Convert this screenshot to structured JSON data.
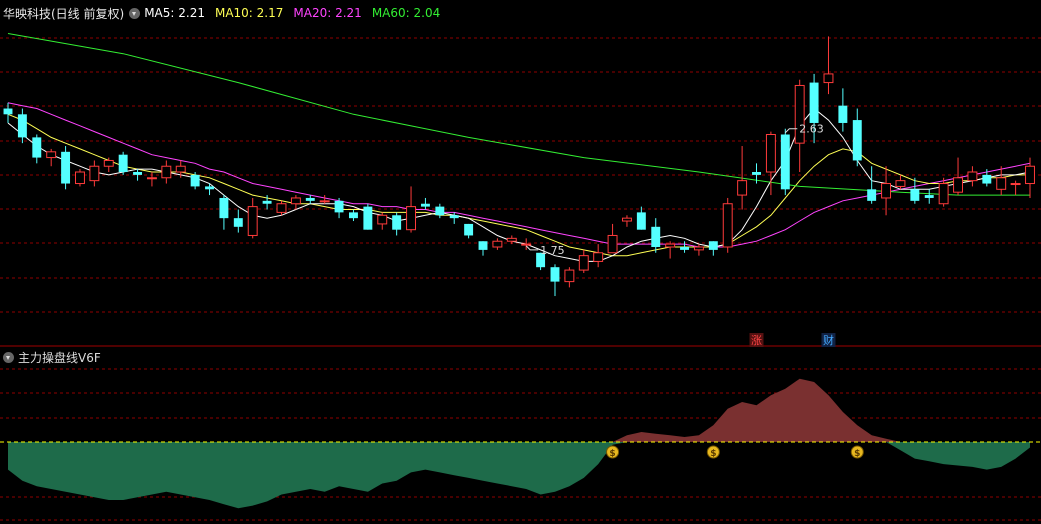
{
  "header": {
    "stock": "华映科技(日线 前复权)",
    "ma": [
      {
        "label": "MA5: 2.21",
        "color": "#ffffff"
      },
      {
        "label": "MA10: 2.17",
        "color": "#ffff55"
      },
      {
        "label": "MA20: 2.21",
        "color": "#ff44ff"
      },
      {
        "label": "MA60: 2.04",
        "color": "#33ee33"
      }
    ]
  },
  "indicator": {
    "title": "主力操盘线V6F"
  },
  "colors": {
    "up": "#ff3b3b",
    "down": "#54ffff",
    "green_area": "#1e6b4a",
    "red_area": "#7a3030",
    "zero_line": "#ffff00",
    "grid": "#c00000"
  },
  "chart_data": [
    {
      "type": "candlestick",
      "title": "",
      "ylim": [
        1.66,
        2.7
      ],
      "annotations": [
        {
          "text": "2.63",
          "at": "high",
          "index": 54
        },
        {
          "text": "1.75",
          "at": "low",
          "index": 36
        },
        {
          "text": "涨",
          "index": 52,
          "color": "#ff4444",
          "bg": "#551111"
        },
        {
          "text": "财",
          "index": 57,
          "color": "#44aaff",
          "bg": "#112244"
        }
      ],
      "ohlc": [
        [
          2.4,
          2.42,
          2.35,
          2.38
        ],
        [
          2.38,
          2.4,
          2.28,
          2.3
        ],
        [
          2.3,
          2.31,
          2.21,
          2.23
        ],
        [
          2.23,
          2.26,
          2.2,
          2.25
        ],
        [
          2.25,
          2.27,
          2.12,
          2.14
        ],
        [
          2.14,
          2.19,
          2.13,
          2.18
        ],
        [
          2.15,
          2.22,
          2.13,
          2.2
        ],
        [
          2.2,
          2.23,
          2.18,
          2.22
        ],
        [
          2.24,
          2.25,
          2.17,
          2.18
        ],
        [
          2.18,
          2.19,
          2.15,
          2.17
        ],
        [
          2.16,
          2.18,
          2.13,
          2.16
        ],
        [
          2.16,
          2.22,
          2.14,
          2.2
        ],
        [
          2.18,
          2.22,
          2.16,
          2.2
        ],
        [
          2.17,
          2.18,
          2.12,
          2.13
        ],
        [
          2.13,
          2.14,
          2.1,
          2.12
        ],
        [
          2.09,
          2.1,
          1.98,
          2.02
        ],
        [
          2.02,
          2.05,
          1.97,
          1.99
        ],
        [
          1.96,
          2.09,
          1.95,
          2.06
        ],
        [
          2.08,
          2.1,
          2.05,
          2.07
        ],
        [
          2.04,
          2.08,
          2.03,
          2.07
        ],
        [
          2.07,
          2.1,
          2.05,
          2.09
        ],
        [
          2.09,
          2.1,
          2.07,
          2.08
        ],
        [
          2.08,
          2.1,
          2.07,
          2.08
        ],
        [
          2.08,
          2.09,
          2.02,
          2.04
        ],
        [
          2.04,
          2.05,
          2.01,
          2.02
        ],
        [
          2.06,
          2.07,
          1.98,
          1.98
        ],
        [
          2.0,
          2.04,
          1.98,
          2.03
        ],
        [
          2.03,
          2.04,
          1.96,
          1.98
        ],
        [
          1.98,
          2.13,
          1.97,
          2.06
        ],
        [
          2.07,
          2.09,
          2.05,
          2.06
        ],
        [
          2.06,
          2.07,
          2.02,
          2.03
        ],
        [
          2.03,
          2.04,
          2.0,
          2.02
        ],
        [
          2.0,
          2.0,
          1.95,
          1.96
        ],
        [
          1.94,
          1.94,
          1.89,
          1.91
        ],
        [
          1.92,
          1.95,
          1.91,
          1.94
        ],
        [
          1.94,
          1.96,
          1.93,
          1.95
        ],
        [
          1.93,
          1.95,
          1.91,
          1.93
        ],
        [
          1.9,
          1.9,
          1.84,
          1.85
        ],
        [
          1.85,
          1.86,
          1.75,
          1.8
        ],
        [
          1.8,
          1.85,
          1.78,
          1.84
        ],
        [
          1.84,
          1.91,
          1.83,
          1.89
        ],
        [
          1.87,
          1.93,
          1.85,
          1.9
        ],
        [
          1.9,
          2.0,
          1.9,
          1.96
        ],
        [
          2.01,
          2.03,
          1.99,
          2.02
        ],
        [
          2.04,
          2.06,
          1.98,
          1.98
        ],
        [
          1.99,
          2.02,
          1.9,
          1.92
        ],
        [
          1.92,
          1.94,
          1.88,
          1.93
        ],
        [
          1.92,
          1.94,
          1.9,
          1.91
        ],
        [
          1.91,
          1.93,
          1.89,
          1.92
        ],
        [
          1.94,
          1.94,
          1.89,
          1.91
        ],
        [
          1.92,
          2.09,
          1.9,
          2.07
        ],
        [
          2.1,
          2.27,
          2.05,
          2.15
        ]
      ],
      "ohlc_b": [
        [
          2.18,
          2.21,
          2.14,
          2.17
        ],
        [
          2.18,
          2.32,
          2.1,
          2.31
        ],
        [
          2.31,
          2.33,
          2.1,
          2.12
        ],
        [
          2.28,
          2.5,
          2.18,
          2.48
        ],
        [
          2.49,
          2.52,
          2.28,
          2.35
        ],
        [
          2.49,
          2.65,
          2.45,
          2.52
        ],
        [
          2.41,
          2.47,
          2.32,
          2.35
        ],
        [
          2.36,
          2.4,
          2.2,
          2.22
        ],
        [
          2.12,
          2.2,
          2.07,
          2.08
        ],
        [
          2.09,
          2.2,
          2.03,
          2.14
        ],
        [
          2.13,
          2.17,
          2.12,
          2.15
        ],
        [
          2.12,
          2.16,
          2.07,
          2.08
        ],
        [
          2.1,
          2.12,
          2.07,
          2.09
        ],
        [
          2.07,
          2.16,
          2.06,
          2.14
        ],
        [
          2.11,
          2.23,
          2.1,
          2.16
        ],
        [
          2.15,
          2.2,
          2.13,
          2.18
        ],
        [
          2.17,
          2.19,
          2.13,
          2.14
        ],
        [
          2.12,
          2.2,
          2.1,
          2.16
        ],
        [
          2.14,
          2.15,
          2.1,
          2.14
        ],
        [
          2.14,
          2.23,
          2.09,
          2.2
        ]
      ],
      "ma5": [
        2.35,
        2.31,
        2.27,
        2.24,
        2.22,
        2.2,
        2.18,
        2.17,
        2.18,
        2.19,
        2.19,
        2.18,
        2.17,
        2.16,
        2.14,
        2.1,
        2.06,
        2.03,
        2.02,
        2.03,
        2.05,
        2.07,
        2.07,
        2.07,
        2.06,
        2.04,
        2.03,
        2.01,
        2.02,
        2.03,
        2.04,
        2.03,
        2.02,
        1.99,
        1.96,
        1.94,
        1.93,
        1.91,
        1.89,
        1.88,
        1.87,
        1.87,
        1.89,
        1.92,
        1.94,
        1.95,
        1.96,
        1.95,
        1.93,
        1.92,
        1.93,
        1.98,
        2.06,
        2.15,
        2.22,
        2.34,
        2.4,
        2.36,
        2.3,
        2.22,
        2.15,
        2.14,
        2.12,
        2.12,
        2.12,
        2.13,
        2.14,
        2.15,
        2.16,
        2.17,
        2.17,
        2.18
      ],
      "ma10": [
        2.38,
        2.36,
        2.33,
        2.3,
        2.28,
        2.26,
        2.24,
        2.22,
        2.2,
        2.19,
        2.18,
        2.18,
        2.18,
        2.17,
        2.16,
        2.14,
        2.12,
        2.1,
        2.09,
        2.08,
        2.07,
        2.07,
        2.06,
        2.05,
        2.05,
        2.05,
        2.04,
        2.04,
        2.04,
        2.04,
        2.03,
        2.03,
        2.02,
        2.01,
        2.0,
        1.99,
        1.98,
        1.96,
        1.94,
        1.92,
        1.91,
        1.9,
        1.89,
        1.89,
        1.9,
        1.91,
        1.92,
        1.92,
        1.92,
        1.92,
        1.93,
        1.96,
        1.99,
        2.03,
        2.09,
        2.15,
        2.2,
        2.24,
        2.26,
        2.25,
        2.21,
        2.19,
        2.17,
        2.15,
        2.14,
        2.14,
        2.15,
        2.15,
        2.16,
        2.16,
        2.17,
        2.17
      ],
      "ma20": [
        2.42,
        2.41,
        2.4,
        2.38,
        2.36,
        2.34,
        2.32,
        2.3,
        2.28,
        2.26,
        2.24,
        2.23,
        2.22,
        2.21,
        2.19,
        2.18,
        2.16,
        2.14,
        2.13,
        2.12,
        2.11,
        2.1,
        2.09,
        2.08,
        2.07,
        2.07,
        2.06,
        2.06,
        2.05,
        2.05,
        2.04,
        2.04,
        2.03,
        2.02,
        2.01,
        2.0,
        1.99,
        1.98,
        1.97,
        1.96,
        1.95,
        1.94,
        1.93,
        1.93,
        1.93,
        1.93,
        1.93,
        1.93,
        1.92,
        1.92,
        1.92,
        1.93,
        1.94,
        1.96,
        1.98,
        2.01,
        2.04,
        2.06,
        2.08,
        2.09,
        2.1,
        2.11,
        2.12,
        2.13,
        2.14,
        2.15,
        2.16,
        2.17,
        2.18,
        2.19,
        2.2,
        2.21
      ],
      "ma60_points": [
        [
          0,
          2.66
        ],
        [
          8,
          2.59
        ],
        [
          16,
          2.49
        ],
        [
          24,
          2.38
        ],
        [
          32,
          2.3
        ],
        [
          40,
          2.23
        ],
        [
          48,
          2.18
        ],
        [
          55,
          2.13
        ],
        [
          62,
          2.11
        ],
        [
          66,
          2.1
        ],
        [
          71,
          2.1
        ]
      ]
    },
    {
      "type": "area",
      "title": "",
      "zero_label": "",
      "ylim": [
        -0.55,
        0.42
      ],
      "values": [
        -0.2,
        -0.28,
        -0.32,
        -0.34,
        -0.36,
        -0.38,
        -0.4,
        -0.42,
        -0.42,
        -0.4,
        -0.38,
        -0.36,
        -0.38,
        -0.4,
        -0.42,
        -0.45,
        -0.48,
        -0.46,
        -0.43,
        -0.38,
        -0.36,
        -0.34,
        -0.36,
        -0.32,
        -0.34,
        -0.36,
        -0.3,
        -0.28,
        -0.22,
        -0.2,
        -0.22,
        -0.24,
        -0.26,
        -0.28,
        -0.3,
        -0.32,
        -0.34,
        -0.38,
        -0.36,
        -0.32,
        -0.26,
        -0.16,
        -0.02,
        0.04,
        0.06,
        0.05,
        0.04,
        0.03,
        0.04,
        0.1,
        0.2,
        0.24,
        0.22,
        0.28,
        0.32,
        0.38,
        0.36,
        0.28,
        0.18,
        0.1,
        0.04,
        0.02,
        -0.06,
        -0.12,
        -0.14,
        -0.16,
        -0.17,
        -0.18,
        -0.2,
        -0.18,
        -0.12,
        -0.04
      ],
      "markers": [
        {
          "index": 42,
          "symbol": "$"
        },
        {
          "index": 49,
          "symbol": "$"
        },
        {
          "index": 59,
          "symbol": "$"
        }
      ]
    }
  ]
}
